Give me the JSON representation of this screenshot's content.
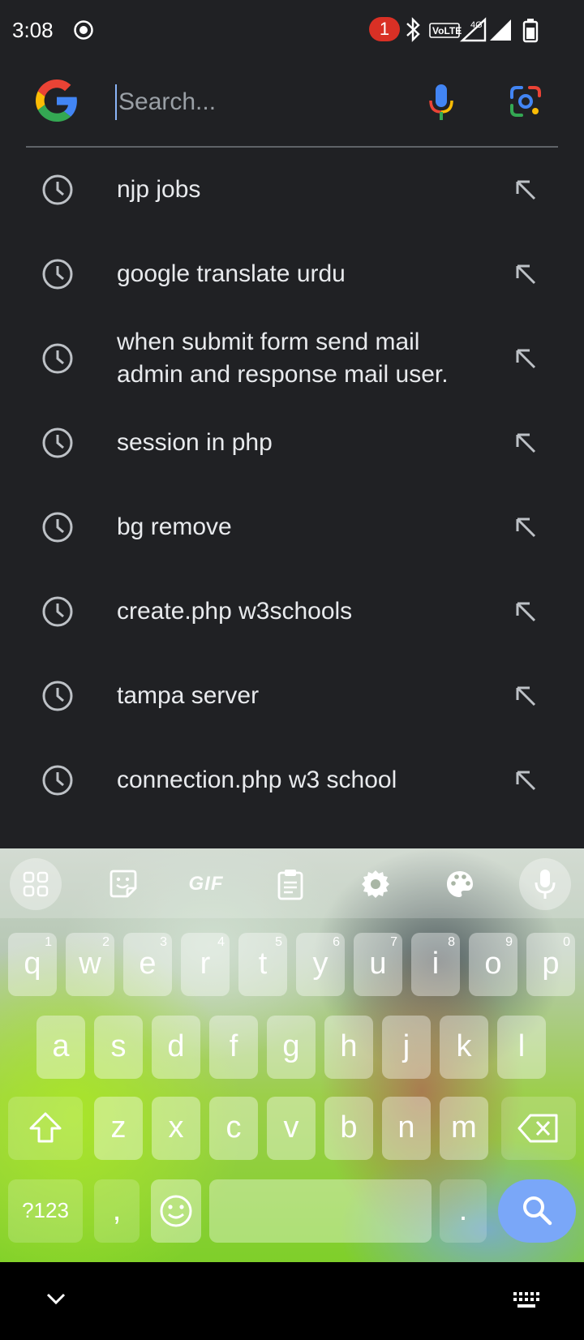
{
  "status_bar": {
    "time": "3:08",
    "notification_count": "1",
    "network_label": "VoLTE",
    "network_type": "4G"
  },
  "search": {
    "placeholder": "Search..."
  },
  "suggestions": [
    {
      "text": "njp jobs"
    },
    {
      "text": "google translate urdu"
    },
    {
      "text": "when submit form send mail admin and response mail user."
    },
    {
      "text": "session in php"
    },
    {
      "text": "bg remove"
    },
    {
      "text": "create.php w3schools"
    },
    {
      "text": "tampa server"
    },
    {
      "text": "connection.php w3 school"
    }
  ],
  "keyboard": {
    "toolbar": {
      "gif_label": "GIF"
    },
    "row1": [
      {
        "key": "q",
        "hint": "1"
      },
      {
        "key": "w",
        "hint": "2"
      },
      {
        "key": "e",
        "hint": "3"
      },
      {
        "key": "r",
        "hint": "4"
      },
      {
        "key": "t",
        "hint": "5"
      },
      {
        "key": "y",
        "hint": "6"
      },
      {
        "key": "u",
        "hint": "7"
      },
      {
        "key": "i",
        "hint": "8"
      },
      {
        "key": "o",
        "hint": "9"
      },
      {
        "key": "p",
        "hint": "0"
      }
    ],
    "row2": [
      "a",
      "s",
      "d",
      "f",
      "g",
      "h",
      "j",
      "k",
      "l"
    ],
    "row3": [
      "z",
      "x",
      "c",
      "v",
      "b",
      "n",
      "m"
    ],
    "symbols_label": "?123",
    "comma": ",",
    "period": "."
  },
  "colors": {
    "background": "#202124",
    "google_blue": "#4285F4",
    "google_red": "#EA4335",
    "google_yellow": "#FBBC05",
    "google_green": "#34A853",
    "search_key": "#7aa7f8"
  }
}
